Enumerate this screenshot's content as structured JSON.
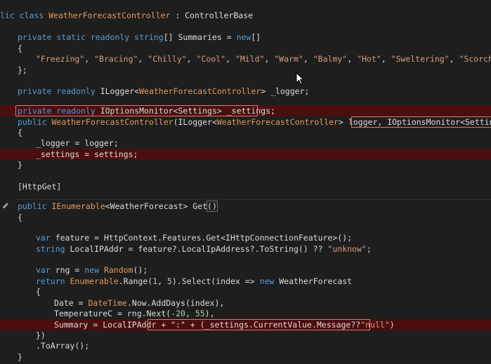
{
  "lines": {
    "l1": {
      "a": "lic class ",
      "b": "WeatherForecastController",
      "c": " : ControllerBase"
    },
    "l2": {
      "a": "private static readonly ",
      "b": "string",
      "c": "[] Summaries = ",
      "d": "new",
      "e": "[]"
    },
    "l3": {
      "a": "{"
    },
    "l4": {
      "s1": "\"Freezing\"",
      "s2": "\"Bracing\"",
      "s3": "\"Chilly\"",
      "s4": "\"Cool\"",
      "s5": "\"Mild\"",
      "s6": "\"Warm\"",
      "s7": "\"Balmy\"",
      "s8": "\"Hot\"",
      "s9": "\"Sweltering\"",
      "s10": "\"Scorching\"",
      "sep": ", "
    },
    "l5": {
      "a": "};"
    },
    "l6": {
      "a": "private readonly ",
      "b": "ILogger<",
      "c": "WeatherForecastController",
      "d": "> _logger;"
    },
    "l7": {
      "a": "private readonly ",
      "b": "IOptionsMonitor<Settings> _settings;"
    },
    "l8": {
      "a": "public ",
      "b": "WeatherForecastController",
      "c": "(ILogger<",
      "d": "WeatherForecastController",
      "e": "> logger",
      "f": ", IOptionsMonitor<Settings> set"
    },
    "l9": {
      "a": "{"
    },
    "l10": {
      "a": "_logger = logger;"
    },
    "l11": {
      "a": "_settings = settings;"
    },
    "l12": {
      "a": "}"
    },
    "l13": {
      "a": "[HttpGet]"
    },
    "l14": {
      "a": "public ",
      "b": "IEnumerable",
      "c": "<WeatherForecast> Get",
      "d": "()"
    },
    "l15": {
      "a": "{"
    },
    "l16": {
      "a": "var",
      "b": " feature = HttpContext.Features.Get<IHttpConnectionFeature>();"
    },
    "l17": {
      "a": "string",
      "b": " LocalIPAddr = feature?.LocalIpAddress?.ToString() ?? ",
      "c": "\"unknow\"",
      "d": ";"
    },
    "l18": {
      "a": "var",
      "b": " rng = ",
      "c": "new ",
      "d": "Random",
      "e": "();"
    },
    "l19": {
      "a": "return ",
      "b": "Enumerable",
      "c": ".Range(",
      "d": "1",
      "e": ", ",
      "f": "5",
      "g": ").Select(index => ",
      "h": "new ",
      "i": "WeatherForecast"
    },
    "l20": {
      "a": "{"
    },
    "l21": {
      "a": "Date = ",
      "b": "DateTime",
      "c": ".Now.AddDays(index),"
    },
    "l22": {
      "a": "TemperatureC = rng.Next(",
      "b": "-20",
      "c": ", ",
      "d": "55",
      "e": "),"
    },
    "l23": {
      "a": "Summary = LocalIPAddr ",
      "b": "+ \":\" + (_settings.CurrentValue.Message??",
      "c": "\"null\"",
      "d": ")"
    },
    "l24": {
      "a": "})"
    },
    "l25": {
      "a": ".ToArray();"
    },
    "l26": {
      "a": "}"
    }
  }
}
